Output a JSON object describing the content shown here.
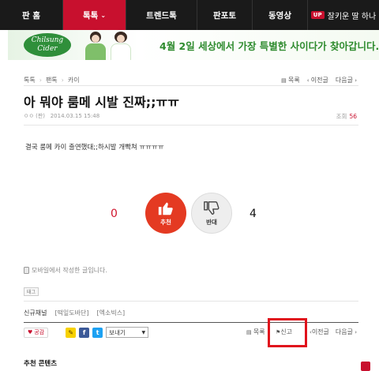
{
  "nav": {
    "items": [
      {
        "label": "판 홈"
      },
      {
        "label": "톡톡",
        "active": true
      },
      {
        "label": "트렌드톡"
      },
      {
        "label": "판포토"
      },
      {
        "label": "동영상"
      }
    ],
    "up_badge": "UP",
    "promo": "잘키운 딸 하나"
  },
  "banner": {
    "logo_text": "Chilsung Cider",
    "headline": "4월 2일 세상에서 가장 특별한 사이다가 찾아갑니다."
  },
  "breadcrumb": [
    "톡톡",
    "팬톡",
    "카이"
  ],
  "post_nav": {
    "list": "목록",
    "prev": "이전글",
    "next": "다음글"
  },
  "post": {
    "title": "아 뭐야 룸메 시발 진짜;;ㅠㅠ",
    "author": "ㅇㅇ (판)",
    "date": "2014.03.15 15:48",
    "views_label": "조회",
    "views": "56",
    "body": "결국 룸메 카이 출연했대;;하시발 개빡쳐 ㅠㅠㅠㅠ"
  },
  "vote": {
    "up_label": "추천",
    "up_count": "0",
    "down_label": "반대",
    "down_count": "4"
  },
  "mobile_note": "모바일에서 작성한 글입니다.",
  "tag_label": "태그",
  "channel": {
    "label": "신규채널",
    "links": [
      "[떡잎도바단]",
      "[엑소빅스]"
    ]
  },
  "share": {
    "like_label": "공감",
    "send_label": "보내기"
  },
  "bottom_nav": {
    "list": "목록",
    "report": "신고",
    "prev": "이전글",
    "next": "다음글"
  },
  "section_title": "추천 콘텐츠",
  "colors": {
    "accent": "#c8102e",
    "up_button": "#e43a22",
    "banner_green": "#2e8b2e"
  }
}
